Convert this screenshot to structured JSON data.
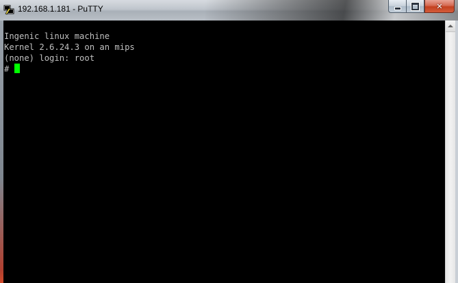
{
  "window": {
    "title": "192.168.1.181 - PuTTY",
    "app_icon": "putty-icon",
    "controls": {
      "minimize_icon": "minimize-icon",
      "maximize_icon": "maximize-icon",
      "close_label": "✕"
    }
  },
  "terminal": {
    "lines": [
      "Ingenic linux machine",
      "Kernel 2.6.24.3 on an mips",
      "(none) login: root"
    ],
    "prompt": "# ",
    "cursor_color": "#00ff00",
    "text_color": "#c0c0c0",
    "background": "#000000"
  }
}
